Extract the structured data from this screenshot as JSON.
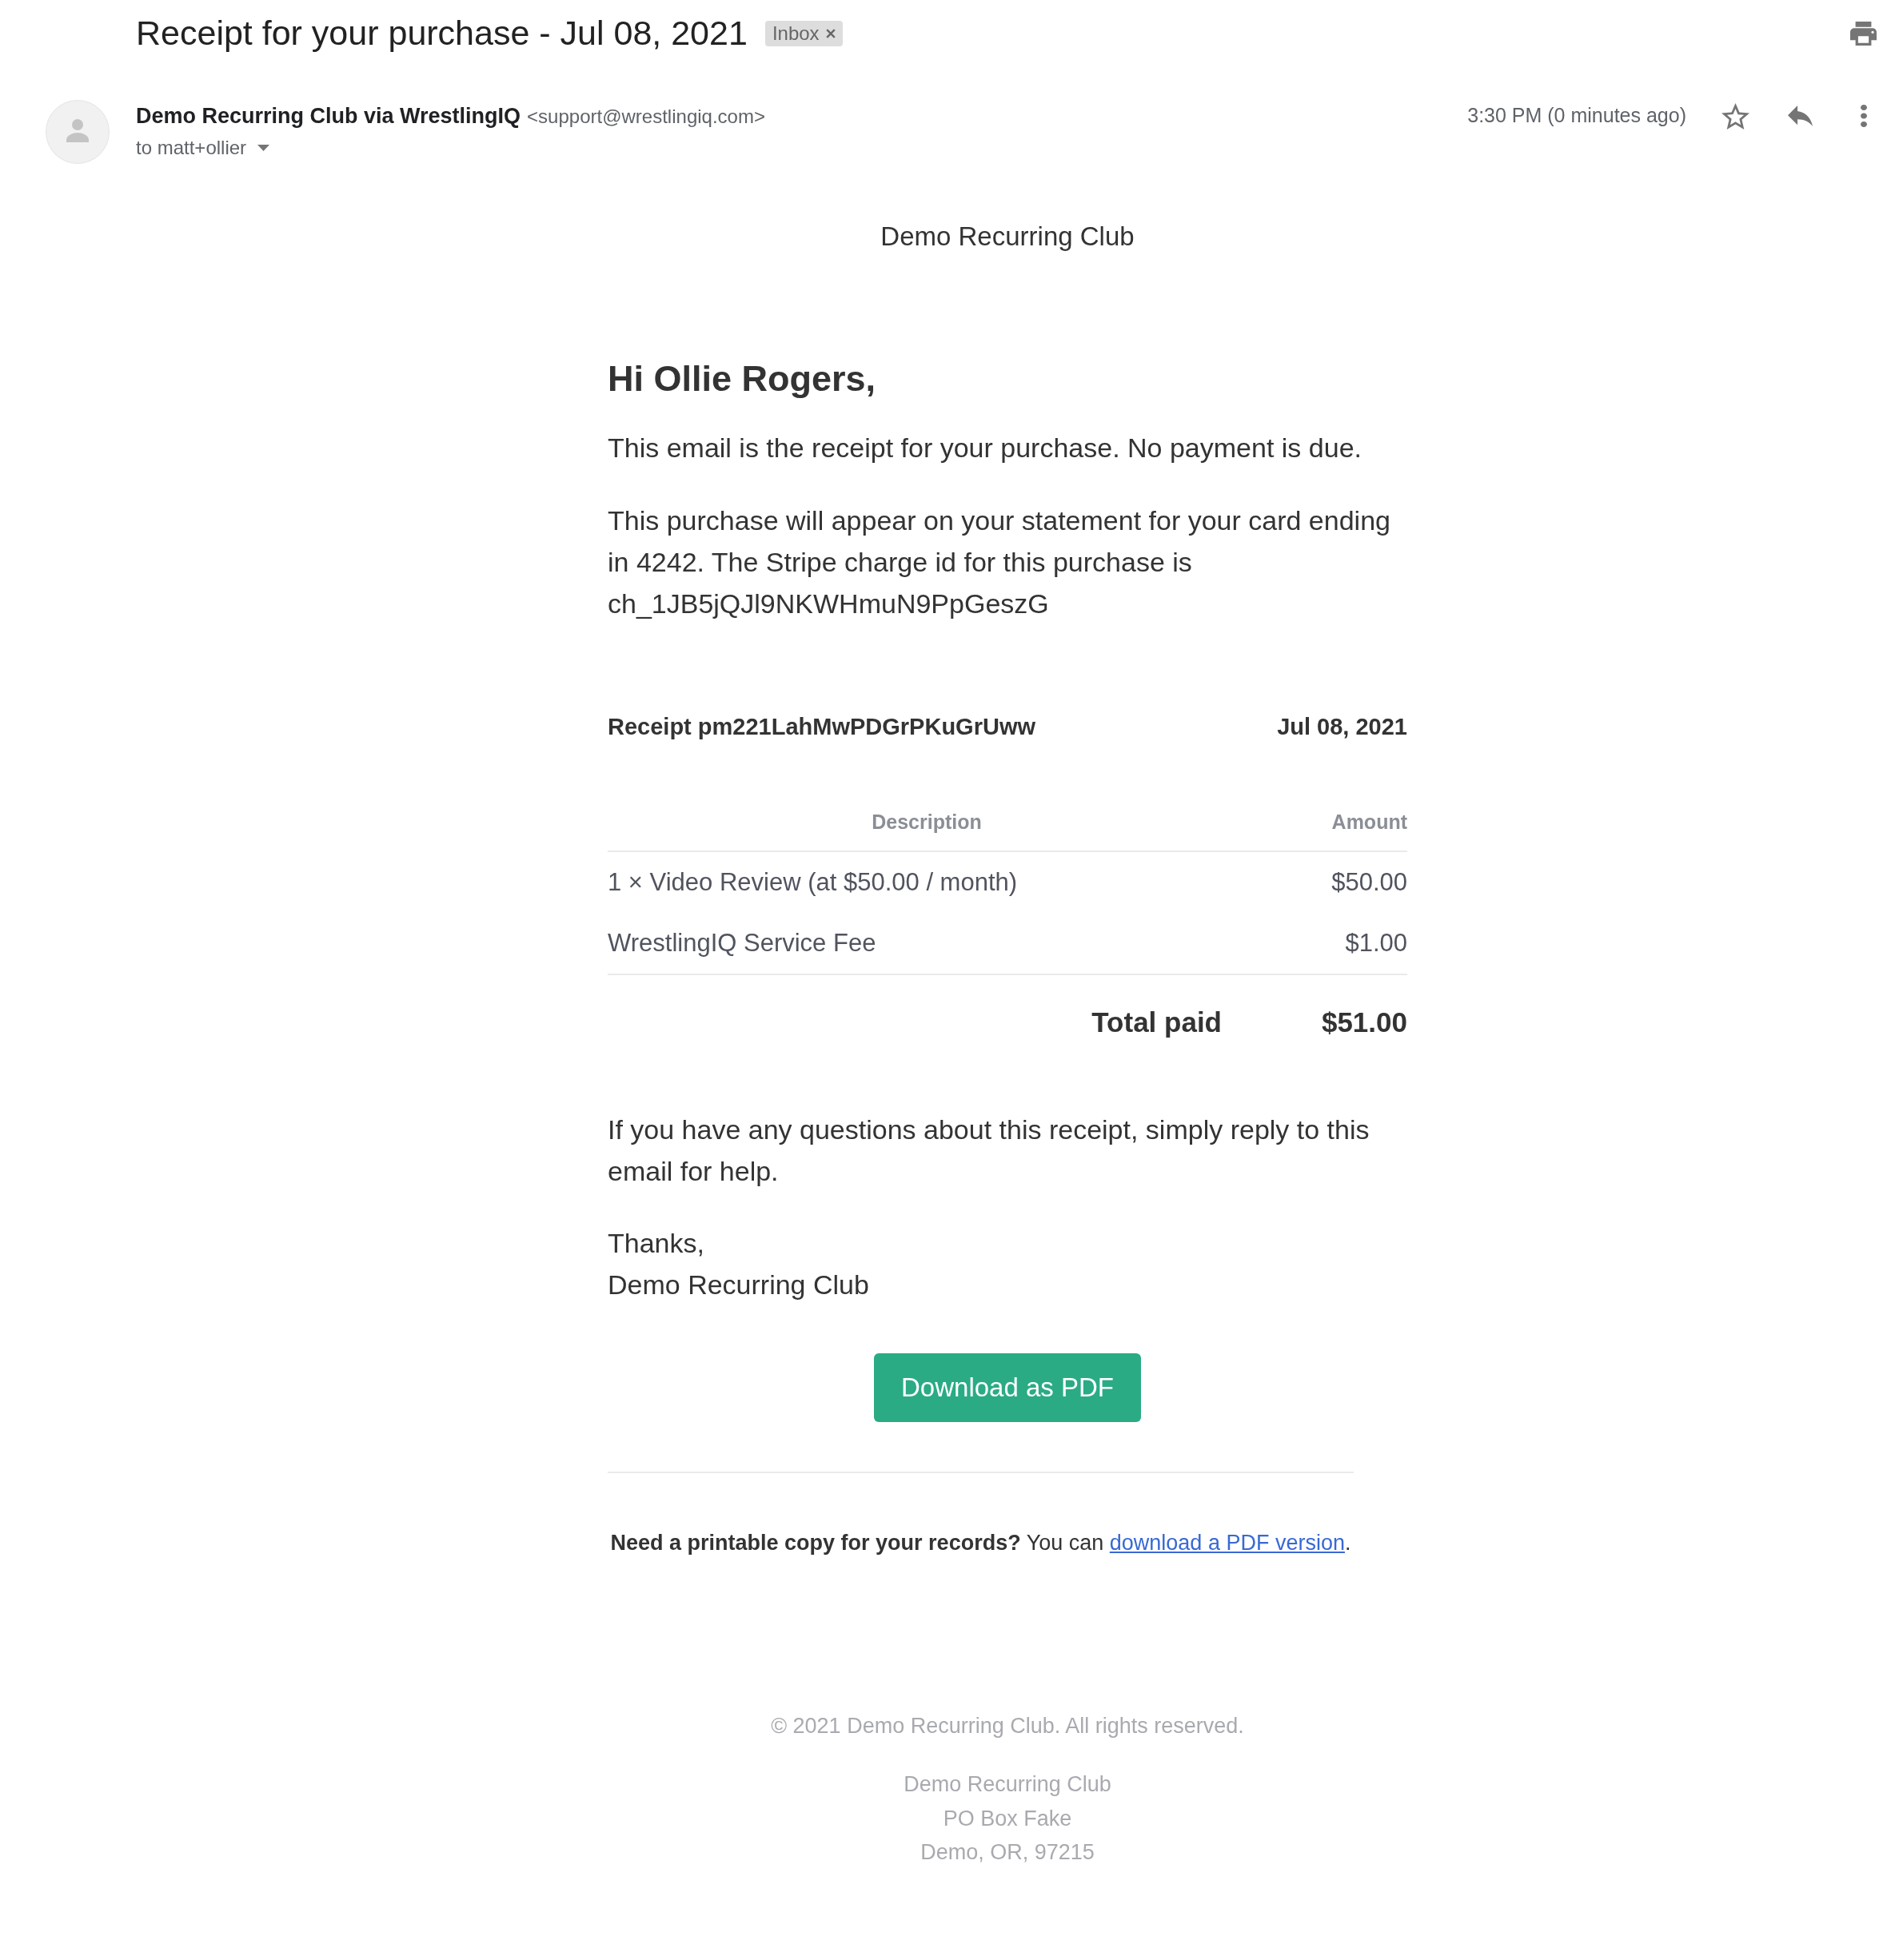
{
  "subject": {
    "title": "Receipt for your purchase - Jul 08, 2021",
    "labels": [
      {
        "text": "Inbox"
      }
    ]
  },
  "message_header": {
    "sender_name": "Demo Recurring Club via WrestlingIQ",
    "sender_email": "<support@wrestlingiq.com>",
    "recipient": "to matt+ollier",
    "time": "3:30 PM (0 minutes ago)",
    "starred": false
  },
  "email": {
    "brand": "Demo Recurring Club",
    "greeting": "Hi Ollie Rogers,",
    "paragraphs": [
      "This email is the receipt for your purchase. No payment is due.",
      "This purchase will appear on your statement for your card ending in 4242. The Stripe charge id for this purchase is ch_1JB5jQJl9NKWHmuN9PpGeszG"
    ],
    "receipt": {
      "title": "Receipt pm221LahMwPDGrPKuGrUww",
      "date": "Jul 08, 2021",
      "columns": [
        "Description",
        "Amount"
      ],
      "rows": [
        {
          "description": "1 × Video Review (at $50.00 / month)",
          "amount": "$50.00"
        },
        {
          "description": "WrestlingIQ Service Fee",
          "amount": "$1.00"
        }
      ],
      "total_label": "Total paid",
      "total": "$51.00"
    },
    "closing": "If you have any questions about this receipt, simply reply to this email for help.",
    "signoff": [
      "Thanks,",
      "Demo Recurring Club"
    ],
    "button": "Download as PDF",
    "printable_note": {
      "text": "**Need a printable copy for your records?** You can",
      "link": "download a PDF version",
      "after": "."
    },
    "footer": {
      "copyright": "© 2021 Demo Recurring Club. All rights reserved.",
      "address": [
        "Demo Recurring Club",
        "PO Box Fake",
        "Demo, OR, 97215"
      ]
    }
  }
}
